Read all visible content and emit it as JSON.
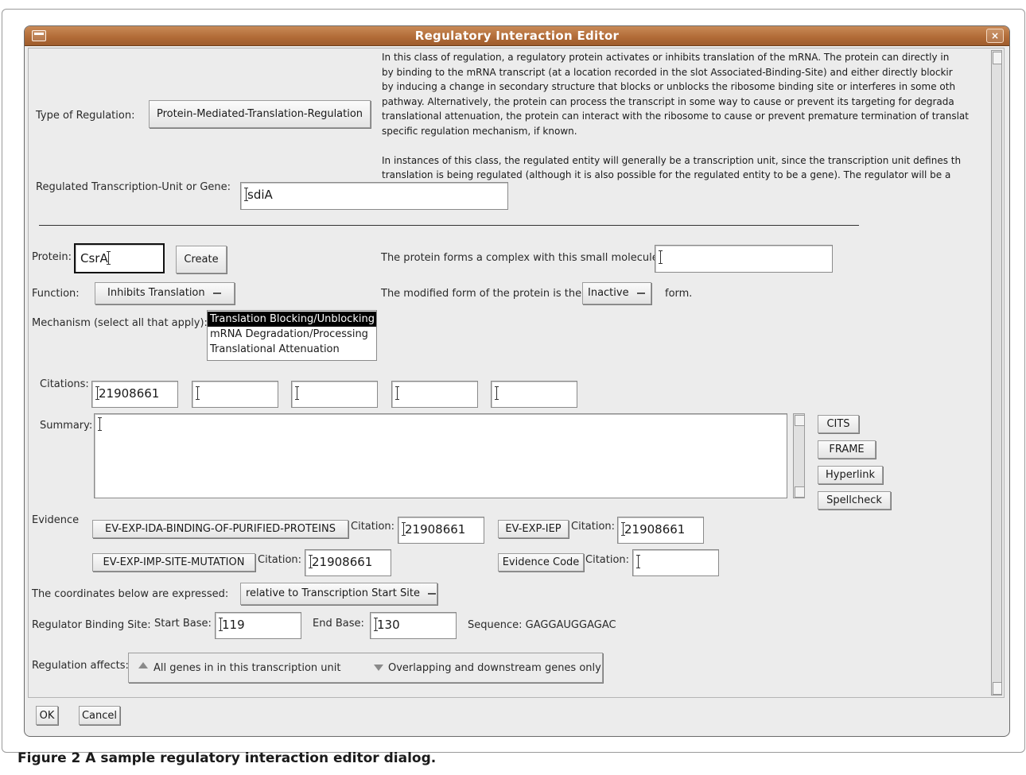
{
  "window": {
    "title": "Regulatory Interaction Editor",
    "close_glyph": "×"
  },
  "type_of_regulation": {
    "label": "Type of Regulation:",
    "button": "Protein-Mediated-Translation-Regulation",
    "description": [
      "In this class of regulation, a regulatory protein activates or inhibits translation of the mRNA.   The protein can directly in",
      "by binding to the mRNA transcript (at a location recorded in the slot Associated-Binding-Site) and either directly blockir",
      "by inducing a change in secondary structure that blocks or unblocks the ribosome binding site or interferes in some oth",
      "pathway.  Alternatively, the protein can process the transcript in some way to cause or prevent its targeting for degrada",
      "translational attenuation, the protein can interact with the ribosome to cause or prevent premature termination of translat",
      "specific regulation mechanism, if known.",
      "",
      "In instances of this class, the regulated entity will generally be a transcription unit, since the transcription unit defines th",
      "translation is being regulated (although it is also possible for the regulated entity to be a gene).  The regulator will be a"
    ]
  },
  "regulated": {
    "label": "Regulated Transcription-Unit or Gene:",
    "value": "sdiA"
  },
  "protein": {
    "label": "Protein:",
    "value": "CsrA",
    "create_button": "Create"
  },
  "complex": {
    "label": "The protein forms a complex with this small molecule:",
    "value": ""
  },
  "function": {
    "label": "Function:",
    "value": "Inhibits Translation"
  },
  "modified": {
    "label": "The modified form of the protein is the",
    "value": "Inactive",
    "suffix": "form."
  },
  "mechanism": {
    "label": "Mechanism (select all that apply):",
    "options": [
      "Translation Blocking/Unblocking",
      "mRNA Degradation/Processing",
      "Translational Attenuation"
    ],
    "selected_index": 0
  },
  "citations": {
    "label": "Citations:",
    "values": [
      "21908661",
      "",
      "",
      "",
      ""
    ]
  },
  "summary": {
    "label": "Summary:",
    "value": "",
    "buttons": {
      "cits": "CITS",
      "frame": "FRAME",
      "hyperlink": "Hyperlink",
      "spellcheck": "Spellcheck"
    }
  },
  "evidence": {
    "label": "Evidence",
    "citation_label": "Citation:",
    "items": [
      {
        "code": "EV-EXP-IDA-BINDING-OF-PURIFIED-PROTEINS",
        "citation": "21908661"
      },
      {
        "code": "EV-EXP-IEP",
        "citation": "21908661"
      },
      {
        "code": "EV-EXP-IMP-SITE-MUTATION",
        "citation": "21908661"
      },
      {
        "code": "Evidence Code",
        "citation": ""
      }
    ]
  },
  "coordinates": {
    "label": "The coordinates below are expressed:",
    "value": "relative to Transcription Start Site"
  },
  "binding_site": {
    "label": "Regulator Binding Site:",
    "start_label": "Start Base:",
    "start": "119",
    "end_label": "End Base:",
    "end": "130",
    "sequence": "Sequence: GAGGAUGGAGAC"
  },
  "regulation_affects": {
    "label": "Regulation affects:",
    "options": [
      "All genes in in this transcription unit",
      "Overlapping and downstream genes only"
    ],
    "selected_index": 0
  },
  "footer": {
    "ok": "OK",
    "cancel": "Cancel"
  },
  "caption": {
    "prefix": "Figure 2",
    "text": "A sample regulatory interaction editor dialog."
  }
}
